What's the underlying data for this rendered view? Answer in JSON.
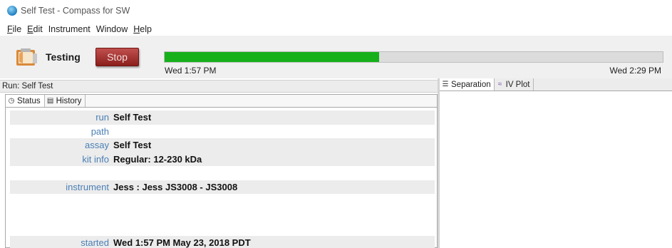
{
  "window": {
    "title": "Self Test - Compass for SW",
    "icon": "compass-app-icon"
  },
  "menu": [
    {
      "label": "File",
      "mnemonic": "F",
      "rest": "ile"
    },
    {
      "label": "Edit",
      "mnemonic": "E",
      "rest": "dit"
    },
    {
      "label": "Instrument",
      "mnemonic": "",
      "rest": "Instrument"
    },
    {
      "label": "Window",
      "mnemonic": "",
      "rest": "Window"
    },
    {
      "label": "Help",
      "mnemonic": "H",
      "rest": "elp"
    }
  ],
  "toolbar": {
    "status_label": "Testing",
    "stop_label": "Stop",
    "progress_fraction": 0.43,
    "start_time": "Wed 1:57 PM",
    "end_time": "Wed 2:29 PM",
    "progress_color": "#16b01a",
    "stop_color": "#a83532"
  },
  "run_header": "Run: Self Test",
  "left_tabs": [
    {
      "label": "Status",
      "icon": "clock-icon",
      "active": true
    },
    {
      "label": "History",
      "icon": "document-icon",
      "active": false
    }
  ],
  "status_rows": [
    {
      "label": "run",
      "value": "Self Test",
      "shaded": true
    },
    {
      "label": "path",
      "value": "",
      "shaded": false
    },
    {
      "label": "assay",
      "value": "Self Test",
      "shaded": true
    },
    {
      "label": "kit info",
      "value": "Regular: 12-230 kDa",
      "shaded": true
    },
    {
      "label": "",
      "value": "",
      "shaded": false
    },
    {
      "label": "instrument",
      "value": "Jess : Jess JS3008 - JS3008",
      "shaded": true
    },
    {
      "label": "",
      "value": "",
      "shaded": false
    },
    {
      "label": "",
      "value": "",
      "shaded": false
    },
    {
      "label": "",
      "value": "",
      "shaded": false
    },
    {
      "label": "started",
      "value": "Wed 1:57 PM May 23, 2018 PDT",
      "shaded": true
    }
  ],
  "right_tabs": [
    {
      "label": "Separation",
      "icon": "list-icon",
      "active": true
    },
    {
      "label": "IV Plot",
      "icon": "plot-icon",
      "active": false
    }
  ]
}
